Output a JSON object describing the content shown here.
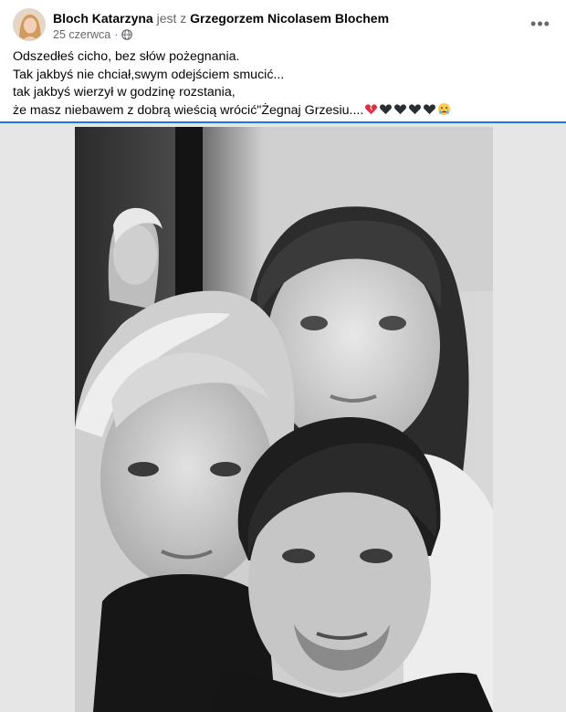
{
  "post": {
    "author": "Bloch Katarzyna",
    "connector": "jest z",
    "tagged": "Grzegorzem Nicolasem Blochem",
    "date": "25 czerwca",
    "separator": "·",
    "privacy_icon": "globe-icon",
    "more_icon": "more-options-icon",
    "more_label": "•••",
    "lines": [
      "Odszedłeś  cicho, bez słów pożegnania.",
      "Tak jakbyś nie chciał,swym odejściem smucić...",
      "tak jakbyś wierzył w godzinę rozstania,",
      "że masz niebawem z dobrą wieścią wrócić\"Żegnaj Grzesiu...."
    ],
    "emoji_icons": [
      "broken-heart-icon",
      "black-heart-icon",
      "black-heart-icon",
      "black-heart-icon",
      "black-heart-icon",
      "crying-face-icon"
    ]
  },
  "photo": {
    "description_icon": "photo-four-people-black-and-white"
  },
  "colors": {
    "accent": "#1877f2",
    "muted_text": "#65676b",
    "photo_background": "#e6e6e6"
  }
}
